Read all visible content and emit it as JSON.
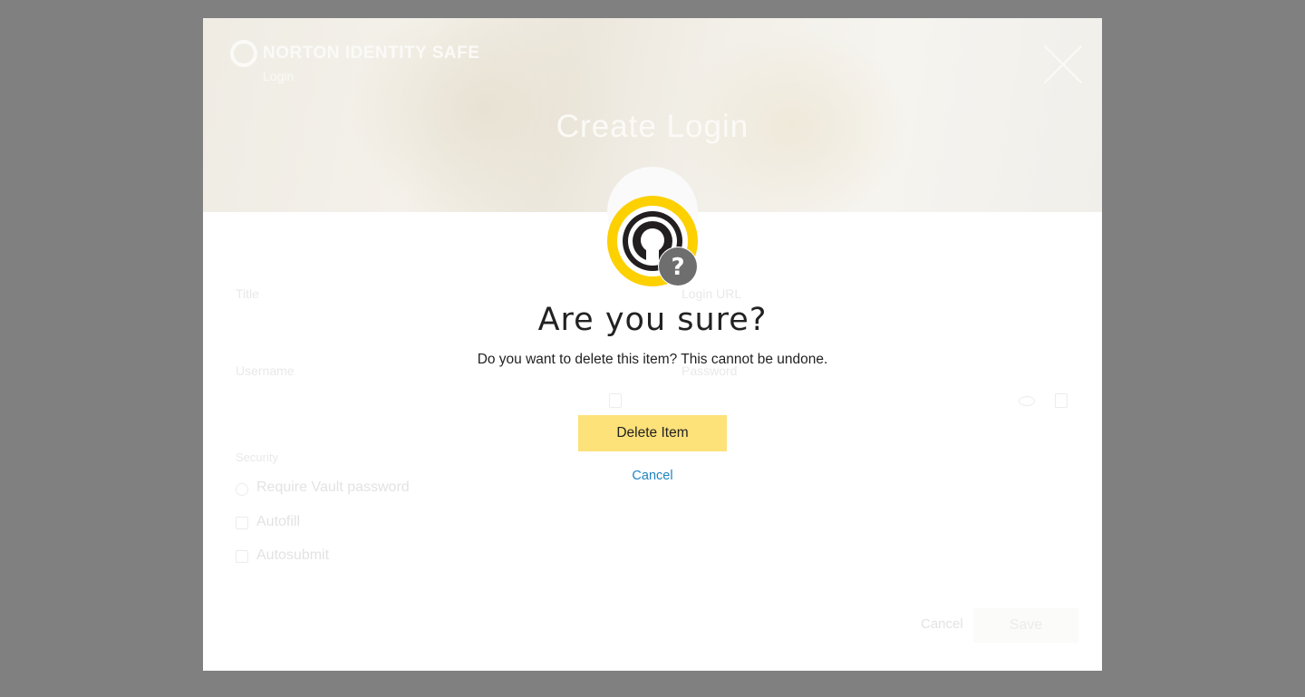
{
  "brand": {
    "name": "NORTON IDENTITY SAFE",
    "subtitle": "Login"
  },
  "header": {
    "title": "Create Login"
  },
  "form": {
    "title_label": "Title",
    "login_url_label": "Login URL",
    "username_label": "Username",
    "password_label": "Password",
    "security_label": "Security",
    "options": [
      {
        "label": "Require Vault password",
        "checked": false
      },
      {
        "label": "Autofill",
        "checked": true
      },
      {
        "label": "Autosubmit",
        "checked": true
      }
    ],
    "cancel_label": "Cancel",
    "save_label": "Save"
  },
  "confirm": {
    "title": "Are you sure?",
    "message": "Do you want to delete this item? This cannot be undone.",
    "delete_label": "Delete Item",
    "cancel_label": "Cancel",
    "icon": "vault-question-icon"
  },
  "colors": {
    "overlay": "#808080",
    "accent_yellow": "#fdd000",
    "delete_button": "#fde179",
    "link_blue": "#1e84c2"
  }
}
